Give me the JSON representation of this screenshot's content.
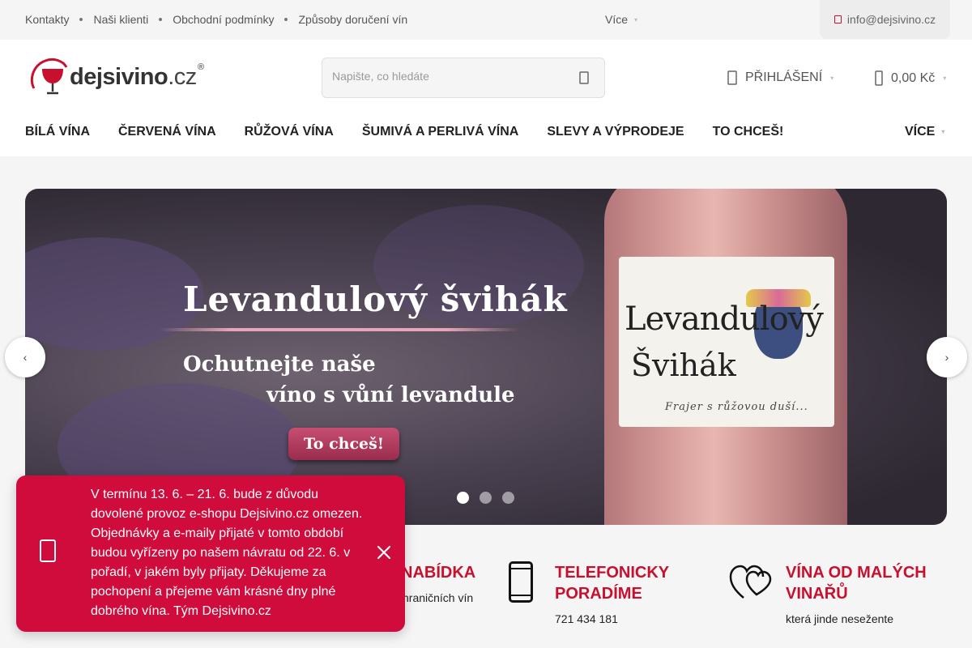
{
  "topbar": {
    "links": [
      "Kontakty",
      "Naši klienti",
      "Obchodní podmínky",
      "Způsoby doručení vín"
    ],
    "more_label": "Více",
    "email": "info@dejsivino.cz"
  },
  "header": {
    "logo": {
      "name": "dejsivino",
      "tld": ".cz",
      "reg": "®"
    },
    "search_placeholder": "Napište, co hledáte",
    "login_label": "PŘIHLÁŠENÍ",
    "cart_total": "0,00 Kč"
  },
  "nav": {
    "items": [
      "BÍLÁ VÍNA",
      "ČERVENÁ VÍNA",
      "RŮŽOVÁ VÍNA",
      "ŠUMIVÁ A PERLIVÁ VÍNA",
      "SLEVY A VÝPRODEJE",
      "TO CHCEŠ!"
    ],
    "more_label": "VÍCE"
  },
  "banner": {
    "title": "Levandulový švihák",
    "subtitle_line1": "Ochutnejte naše",
    "subtitle_line2": "víno s vůní levandule",
    "cta": "To chceš!",
    "label_line1": "Levandulový",
    "label_line2": "Švihák",
    "label_line3": "Frajer s růžovou duší...",
    "slides": 3,
    "active_slide": 1
  },
  "benefits": [
    {
      "title": "NABÍDKA",
      "subtitle": "hraničních vín"
    },
    {
      "title_line1": "TELEFONICKY",
      "title_line2": "PORADÍME",
      "subtitle": "721 434 181"
    },
    {
      "title_line1": "VÍNA OD MALÝCH",
      "title_line2": "VINAŘŮ",
      "subtitle": "která jinde nesežente"
    }
  ],
  "notice": {
    "text": "V termínu 13. 6. – 21. 6. bude z důvodu dovolené provoz e-shopu Dejsivino.cz omezen. Objednávky a e-maily přijaté v tomto období budou vyřízeny po našem návratu od 22. 6. v pořadí, v jakém byly přijaty. Děkujeme za pochopení a přejeme vám krásné dny plné dobrého vína. Tým Dejsivino.cz"
  },
  "colors": {
    "accent": "#c8102e",
    "notice_bg": "#d00c3c"
  }
}
